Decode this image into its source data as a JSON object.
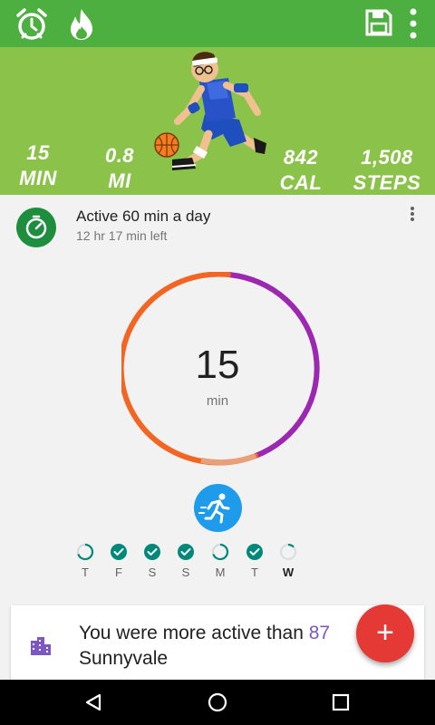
{
  "stats": {
    "minutes": {
      "value": "15",
      "unit": "MIN"
    },
    "miles": {
      "value": "0.8",
      "unit": "MI"
    },
    "calories": {
      "value": "842",
      "unit": "CAL"
    },
    "steps": {
      "value": "1,508",
      "unit": "STEPS"
    }
  },
  "goal": {
    "title": "Active 60 min a day",
    "subtitle": "12 hr 17 min left",
    "progress_value": "15",
    "progress_unit": "min"
  },
  "week": {
    "days": [
      {
        "label": "T",
        "state": "partial",
        "current": false
      },
      {
        "label": "F",
        "state": "done",
        "current": false
      },
      {
        "label": "S",
        "state": "done",
        "current": false
      },
      {
        "label": "S",
        "state": "done",
        "current": false
      },
      {
        "label": "M",
        "state": "partial",
        "current": false
      },
      {
        "label": "T",
        "state": "done",
        "current": false
      },
      {
        "label": "W",
        "state": "empty",
        "current": true
      }
    ]
  },
  "banner": {
    "text_start": "You were more active than ",
    "highlight": "87",
    "line2": "Sunnyvale"
  },
  "fab": {
    "label": "+"
  },
  "colors": {
    "topbar": "#4caf3f",
    "hero": "#8bc34a",
    "ring_orange": "#f26522",
    "ring_purple": "#9c27b0",
    "check_teal": "#00897b",
    "run_blue": "#1e9bea",
    "fab_red": "#e53935"
  }
}
